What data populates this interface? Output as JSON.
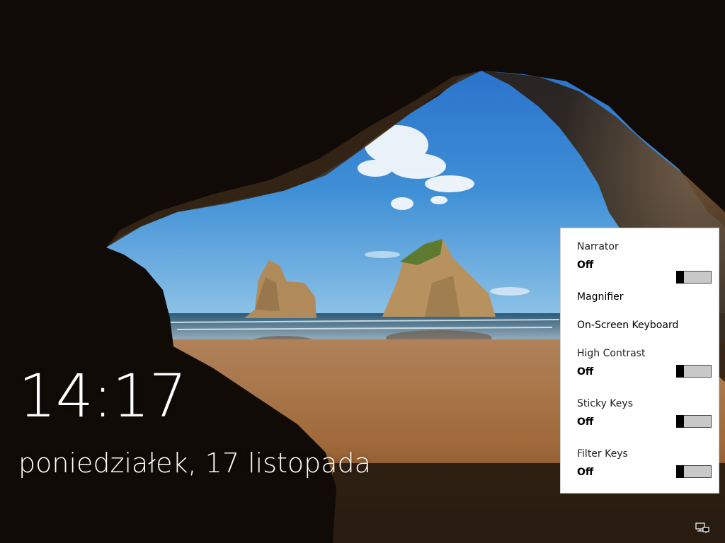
{
  "lock_screen": {
    "time": "14:17",
    "date": "poniedziałek, 17 listopada"
  },
  "ease_of_access": {
    "narrator": {
      "label": "Narrator",
      "state": "Off",
      "on": false
    },
    "magnifier": {
      "label": "Magnifier"
    },
    "onscreen_keyboard": {
      "label": "On-Screen Keyboard"
    },
    "high_contrast": {
      "label": "High Contrast",
      "state": "Off",
      "on": false
    },
    "sticky_keys": {
      "label": "Sticky Keys",
      "state": "Off",
      "on": false
    },
    "filter_keys": {
      "label": "Filter Keys",
      "state": "Off",
      "on": false
    }
  },
  "taskbar": {
    "icon": "network-icon"
  }
}
